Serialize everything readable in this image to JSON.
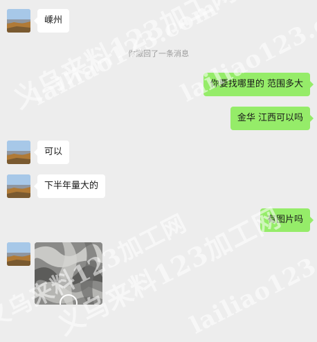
{
  "system_notice": "你撤回了一条消息",
  "messages": [
    {
      "side": "in",
      "text": "嵊州"
    },
    {
      "side": "out",
      "text": "你要找哪里的 范围多大"
    },
    {
      "side": "out",
      "text": "金华 江西可以吗"
    },
    {
      "side": "in",
      "text": "可以"
    },
    {
      "side": "in",
      "text": "下半年量大的"
    },
    {
      "side": "out",
      "text": "有图片吗"
    }
  ],
  "watermark": {
    "text": "义乌来料123加工网",
    "url_text": "lailiao123.com"
  },
  "colors": {
    "background": "#ededed",
    "incoming_bubble": "#ffffff",
    "outgoing_bubble": "#95ec69",
    "notice_text": "#9a9a9a"
  }
}
